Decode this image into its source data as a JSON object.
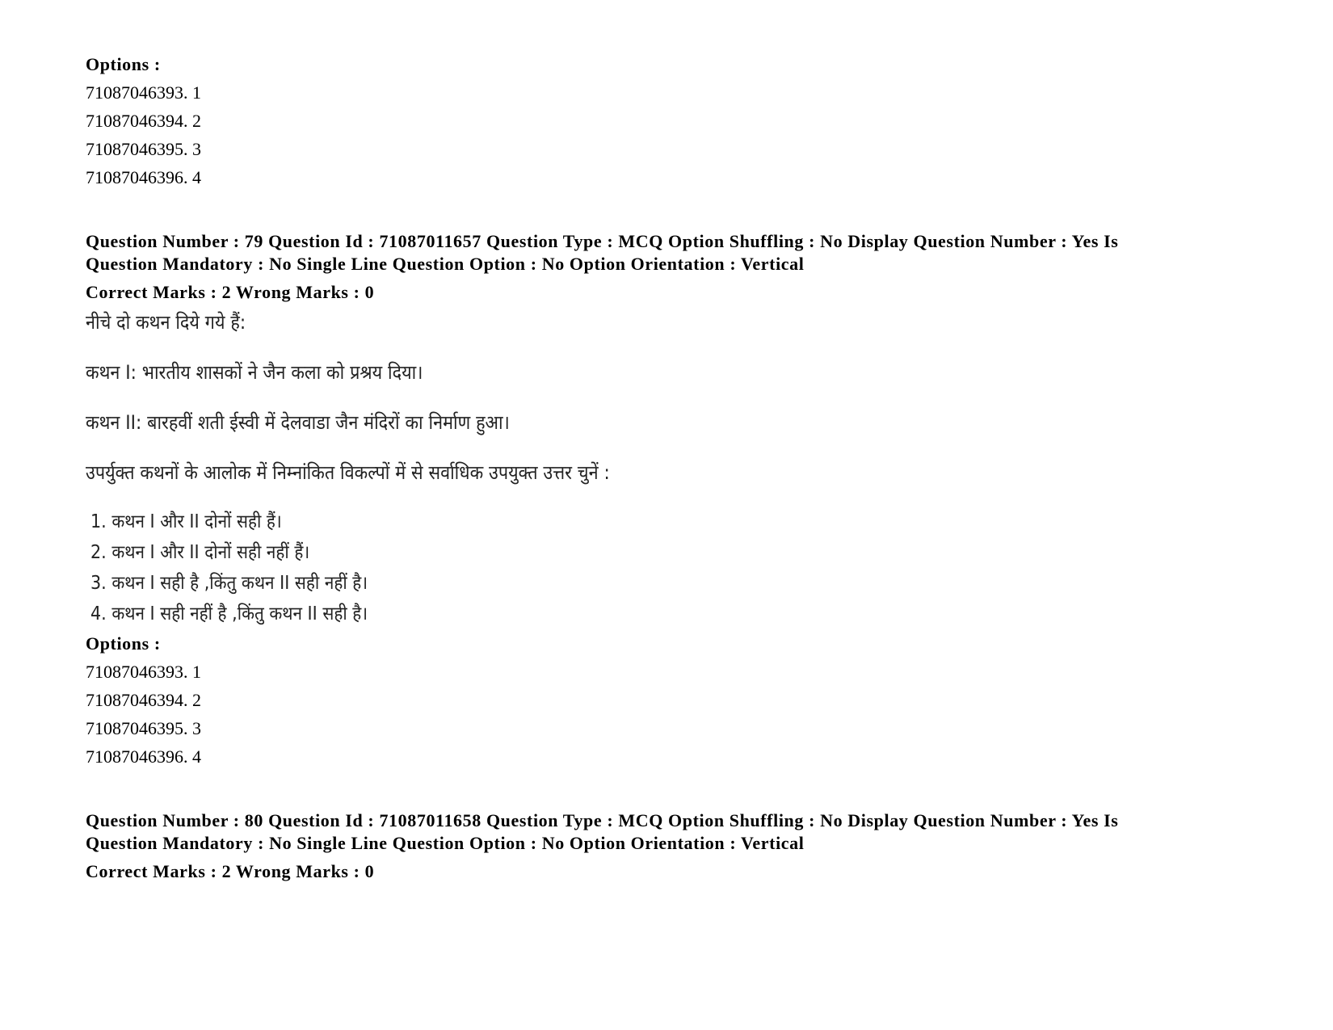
{
  "prev_question": {
    "options_label": "Options :",
    "options": [
      "71087046393. 1",
      "71087046394. 2",
      "71087046395. 3",
      "71087046396. 4"
    ]
  },
  "question_79": {
    "meta_line1": "Question Number : 79 Question Id : 71087011657 Question Type : MCQ Option Shuffling : No Display Question Number : Yes Is",
    "meta_line2": "Question Mandatory : No Single Line Question Option : No Option Orientation : Vertical",
    "marks": "Correct Marks : 2 Wrong Marks : 0",
    "intro": "नीचे दो कथन दिये गये हैं:",
    "statement_1": "कथन I: भारतीय शासकों ने जैन कला को प्रश्रय दिया।",
    "statement_2": "कथन II: बारहवीं शती ईस्वी  में देलवाडा जैन मंदिरों का निर्माण हुआ।",
    "instruction": "उपर्युक्त कथनों के आलोक में निम्नांकित विकल्पों में से सर्वाधिक उपयुक्त उत्तर चुनें :",
    "choices": [
      "1. कथन I और II दोनों सही हैं।",
      "2. कथन I और II दोनों सही नहीं  हैं।",
      "3. कथन I सही है ,किंतु कथन II सही नहीं है।",
      "4. कथन I सही नहीं है ,किंतु कथन II सही  है।"
    ],
    "options_label": "Options :",
    "options": [
      "71087046393. 1",
      "71087046394. 2",
      "71087046395. 3",
      "71087046396. 4"
    ]
  },
  "question_80": {
    "meta_line1": "Question Number : 80 Question Id : 71087011658 Question Type : MCQ Option Shuffling : No Display Question Number : Yes Is",
    "meta_line2": "Question Mandatory : No Single Line Question Option : No Option Orientation : Vertical",
    "marks": "Correct Marks : 2 Wrong Marks : 0"
  }
}
